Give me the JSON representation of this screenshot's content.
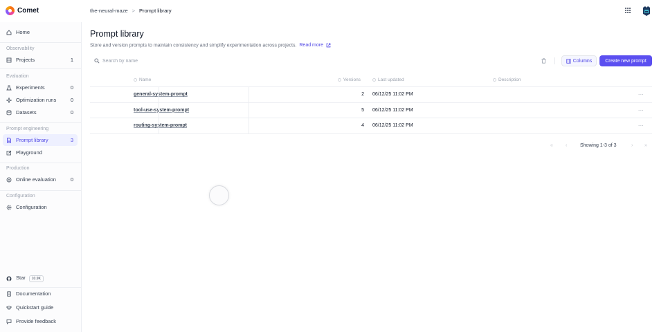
{
  "app": {
    "name": "Comet"
  },
  "breadcrumb": {
    "workspace": "the-neural-maze",
    "separator": ">",
    "current": "Prompt library"
  },
  "sidebar": {
    "home": {
      "label": "Home"
    },
    "sections": {
      "observability": "Observability",
      "evaluation": "Evaluation",
      "prompt_engineering": "Prompt engineering",
      "production": "Production",
      "configuration": "Configuration"
    },
    "items": {
      "projects": {
        "label": "Projects",
        "count": "1"
      },
      "experiments": {
        "label": "Experiments",
        "count": "0"
      },
      "optimization_runs": {
        "label": "Optimization runs",
        "count": "0"
      },
      "datasets": {
        "label": "Datasets",
        "count": "0"
      },
      "prompt_library": {
        "label": "Prompt library",
        "count": "3"
      },
      "playground": {
        "label": "Playground"
      },
      "online_evaluation": {
        "label": "Online evaluation",
        "count": "0"
      },
      "configuration": {
        "label": "Configuration"
      }
    },
    "footer": {
      "star": {
        "label": "Star",
        "badge": "10.9K"
      },
      "documentation": "Documentation",
      "quickstart": "Quickstart guide",
      "feedback": "Provide feedback"
    }
  },
  "main": {
    "title": "Prompt library",
    "description": "Store and version prompts to maintain consistency and simplify experimentation across projects.",
    "read_more": "Read more",
    "search": {
      "placeholder": "Search by name"
    },
    "columns_label": "Columns",
    "create_label": "Create new prompt",
    "table": {
      "headers": {
        "name": "Name",
        "versions": "Versions",
        "last_updated": "Last updated",
        "description": "Description"
      },
      "rows": [
        {
          "name": "general-system-prompt",
          "versions": "2",
          "last_updated": "06/12/25 11:02 PM",
          "more": "..."
        },
        {
          "name": "tool-use-system-prompt",
          "versions": "5",
          "last_updated": "06/12/25 11:02 PM",
          "more": "..."
        },
        {
          "name": "routing-system-prompt",
          "versions": "4",
          "last_updated": "06/12/25 11:02 PM",
          "more": "..."
        }
      ]
    },
    "pagination": {
      "info": "Showing 1-3 of 3",
      "first": "«",
      "prev": "‹",
      "next": "›",
      "last": "»"
    }
  },
  "colors": {
    "accent": "#5b4ff0",
    "active_bg": "#eef0ff"
  }
}
